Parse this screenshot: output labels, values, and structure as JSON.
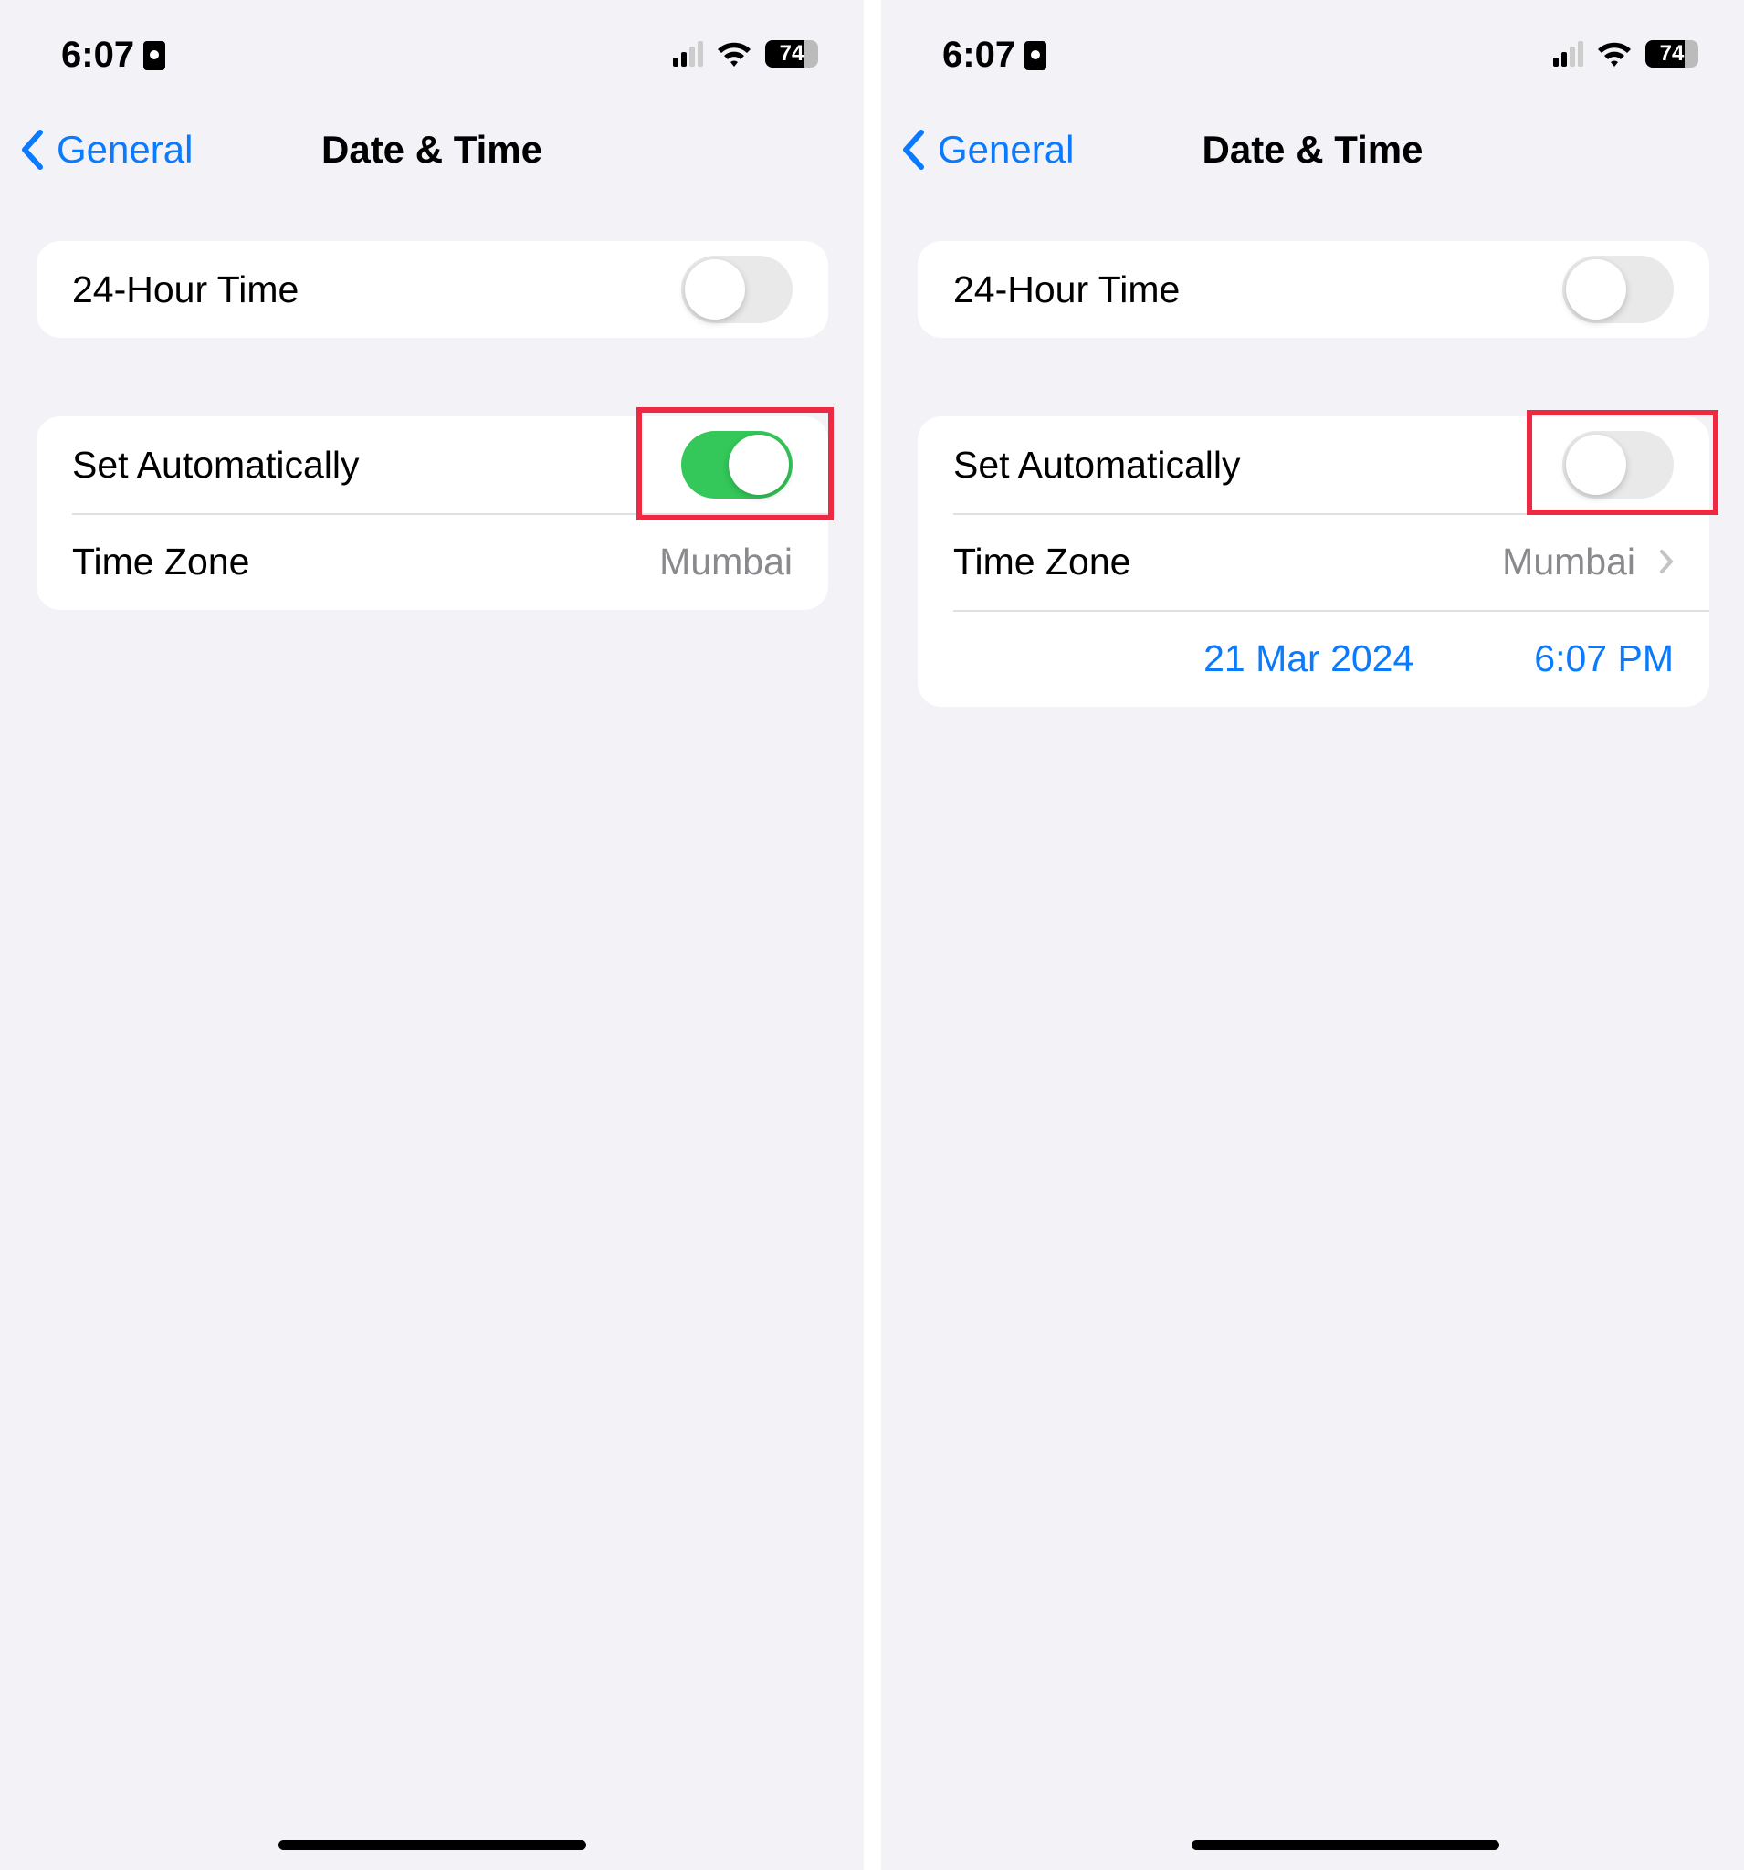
{
  "status": {
    "time": "6:07",
    "battery": "74"
  },
  "nav": {
    "back_label": "General",
    "title": "Date & Time"
  },
  "settings": {
    "hour24_label": "24-Hour Time",
    "set_auto_label": "Set Automatically",
    "timezone_label": "Time Zone",
    "timezone_value": "Mumbai"
  },
  "left": {
    "hour24_on": false,
    "set_auto_on": true
  },
  "right": {
    "hour24_on": false,
    "set_auto_on": false,
    "date": "21 Mar 2024",
    "time": "6:07 PM"
  },
  "colors": {
    "accent": "#0a7aff",
    "toggle_on": "#34c759",
    "highlight": "#ee2a43"
  }
}
